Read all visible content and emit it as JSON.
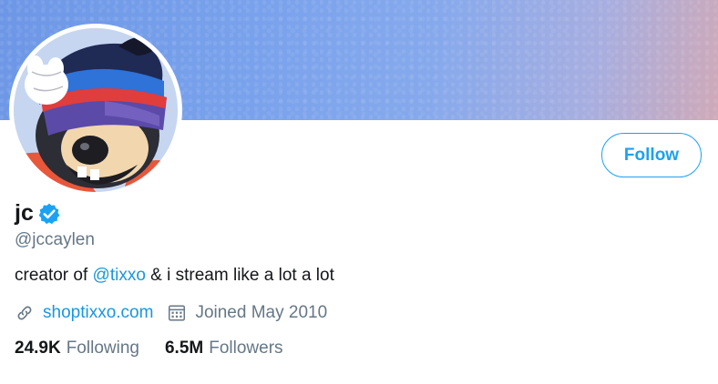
{
  "profile": {
    "name": "jc",
    "handle": "@jccaylen",
    "bio_prefix": "creator of ",
    "bio_mention": "@tixxo",
    "bio_suffix": " & i stream like a lot a lot",
    "website": "shoptixxo.com",
    "joined": "Joined May 2010",
    "verified": true
  },
  "actions": {
    "follow_label": "Follow"
  },
  "stats": {
    "following_count": "24.9K",
    "following_label": "Following",
    "followers_count": "6.5M",
    "followers_label": "Followers"
  },
  "icons": {
    "verified": "verified-badge-icon",
    "link": "link-icon",
    "calendar": "calendar-icon"
  },
  "colors": {
    "accent": "#1da1f2",
    "link": "#1b95e0",
    "secondary_text": "#657786",
    "primary_text": "#14171a",
    "banner": "#79a2ec"
  }
}
